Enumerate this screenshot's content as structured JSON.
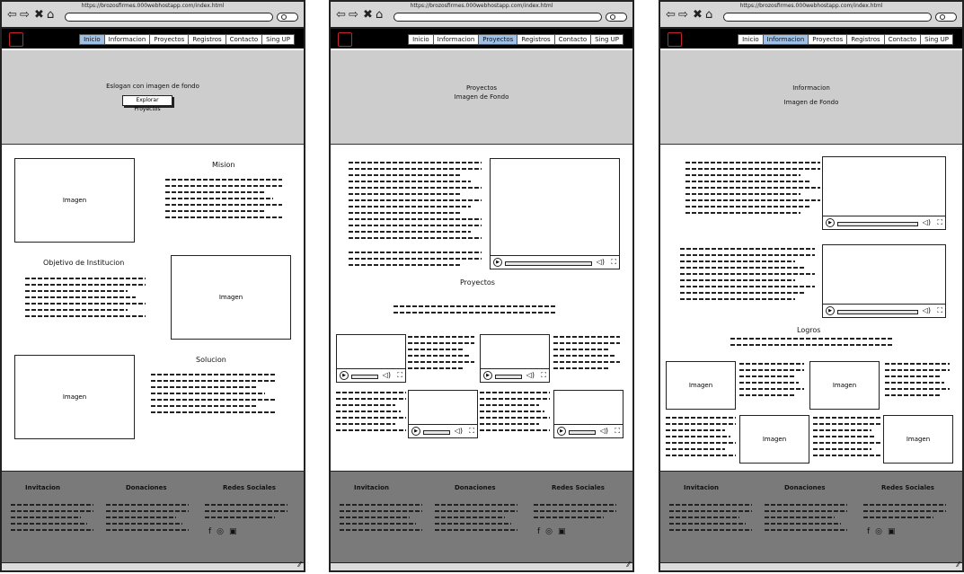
{
  "browser": {
    "url": "https://brozosfirmes.000webhostapp.com/index.html",
    "icons": [
      "back-arrow-icon",
      "forward-arrow-icon",
      "close-icon",
      "home-icon",
      "search-icon"
    ]
  },
  "nav": {
    "items": [
      "Inicio",
      "Informacion",
      "Proyectos",
      "Registros",
      "Contacto",
      "Sing UP"
    ]
  },
  "screen1": {
    "active": "Inicio",
    "hero_text": "Eslogan con imagen de fondo",
    "cta_label": "Explorar Proyectos",
    "image_label": "Imagen",
    "mision": "Mision",
    "objetivo": "Objetivo de Institucion",
    "solucion": "Solucion"
  },
  "screen2": {
    "active": "Proyectos",
    "hero_line1": "Proyectos",
    "hero_line2": "Imagen de Fondo",
    "section_title": "Proyectos"
  },
  "screen3": {
    "active": "Informacion",
    "hero_line1": "Informacion",
    "hero_line2": "Imagen de Fondo",
    "logros": "Logros",
    "image_label": "Imagen"
  },
  "footer": {
    "invitacion": "Invitacion",
    "donaciones": "Donaciones",
    "redes": "Redes Sociales",
    "social_icons": [
      "facebook-icon",
      "instagram-icon",
      "youtube-icon"
    ]
  }
}
